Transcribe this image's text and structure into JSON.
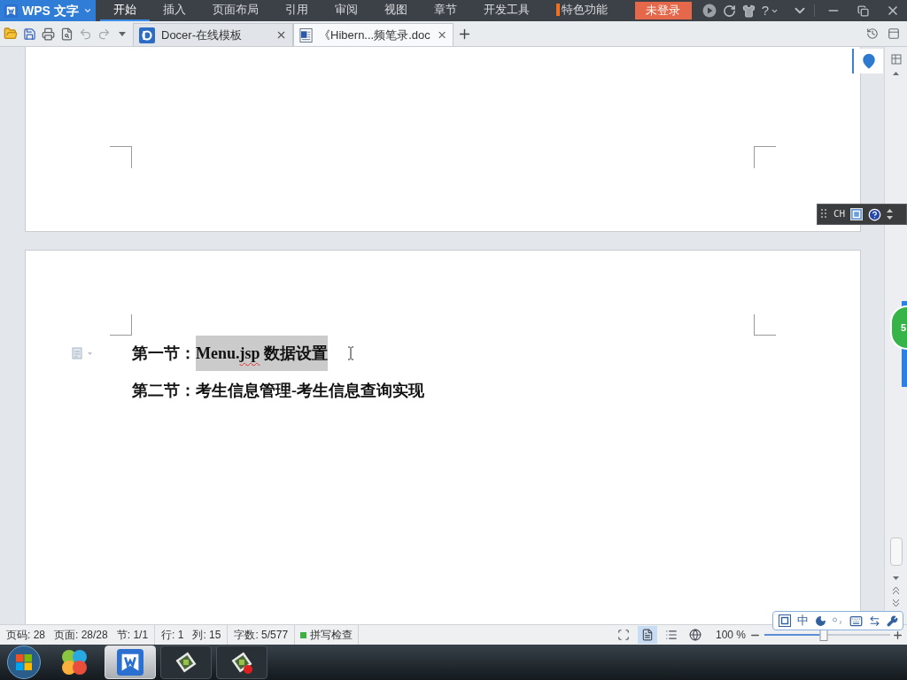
{
  "app_menu": {
    "label": "WPS 文字"
  },
  "menu_tabs": [
    {
      "label": "开始",
      "selected": true,
      "kind": "plain"
    },
    {
      "label": "插入",
      "selected": false,
      "kind": "plain"
    },
    {
      "label": "页面布局",
      "selected": false,
      "kind": "plain"
    },
    {
      "label": "引用",
      "selected": false,
      "kind": "plain"
    },
    {
      "label": "审阅",
      "selected": false,
      "kind": "plain"
    },
    {
      "label": "视图",
      "selected": false,
      "kind": "plain"
    },
    {
      "label": "章节",
      "selected": false,
      "kind": "plain"
    },
    {
      "label": "开发工具",
      "selected": false,
      "kind": "plain"
    },
    {
      "label": "特色功能",
      "selected": false,
      "kind": "featured"
    }
  ],
  "login_button": {
    "label": "未登录"
  },
  "help_menu": {
    "label": "?"
  },
  "doc_tabs": [
    {
      "label": "Docer-在线模板",
      "selected": false,
      "kind": "template"
    },
    {
      "label": "《Hibern...频笔录.doc",
      "selected": true,
      "kind": "document"
    }
  ],
  "document": {
    "paragraphs": [
      {
        "handle": true,
        "segments": [
          {
            "text": "第一节：",
            "selected": false,
            "misspelled": false
          },
          {
            "text": "Menu.",
            "selected": true,
            "misspelled": false
          },
          {
            "text": "jsp",
            "selected": true,
            "misspelled": true
          },
          {
            "text": " 数据设置",
            "selected": true,
            "misspelled": false
          }
        ]
      },
      {
        "handle": false,
        "segments": [
          {
            "text": "第二节：考生信息管理-考生信息查询实现",
            "selected": false,
            "misspelled": false
          }
        ]
      }
    ]
  },
  "ime_bar": {
    "label": "CH"
  },
  "floating_ball": {
    "label": "5"
  },
  "ime_toolbar": {
    "label": "中"
  },
  "status_bar": {
    "groups": [
      {
        "items": [
          "页码: 28",
          "页面: 28/28",
          "节: 1/1"
        ]
      },
      {
        "items": [
          "行: 1",
          "列: 15"
        ]
      },
      {
        "items": [
          "字数: 5/577"
        ]
      }
    ],
    "spell_check": {
      "label": "拼写检查",
      "on": true
    },
    "view_modes": [
      {
        "kind": "full_screen",
        "selected": false
      },
      {
        "kind": "page",
        "selected": true
      },
      {
        "kind": "outline",
        "selected": false
      },
      {
        "kind": "web",
        "selected": false
      }
    ],
    "zoom": {
      "reading": "100 %",
      "level": 0.47
    }
  },
  "taskbar": {
    "buttons": [
      {
        "kind": "wps",
        "active": true
      },
      {
        "kind": "app",
        "active": false
      },
      {
        "kind": "recorder",
        "active": false
      }
    ]
  }
}
